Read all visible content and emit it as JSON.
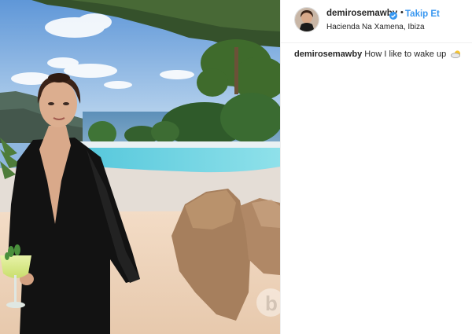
{
  "post": {
    "username": "demirosemawby",
    "follow_label": "Takip Et",
    "separator": "•",
    "location": "Hacienda Na Xamena, Ibiza",
    "caption_username": "demirosemawby",
    "caption_text": "How I like to wake up",
    "caption_emoji_icon": "sun-behind-cloud-icon",
    "verified_icon": "verified-badge-icon"
  },
  "colors": {
    "accent": "#3897f0",
    "text": "#262626",
    "divider": "#efefef"
  }
}
